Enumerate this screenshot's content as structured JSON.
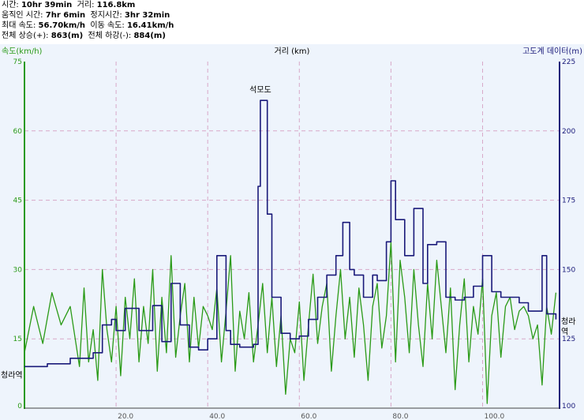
{
  "stats": {
    "time_label": "시간:",
    "time_value": "10hr 39min",
    "distance_label": "거리:",
    "distance_value": "116.8km",
    "moving_time_label": "움직인 시간:",
    "moving_time_value": "7hr 6min",
    "stopped_time_label": "정지시간:",
    "stopped_time_value": "3hr 32min",
    "max_speed_label": "최대 속도:",
    "max_speed_value": "56.70km/h",
    "moving_speed_label": "이동 속도:",
    "moving_speed_value": "16.41km/h",
    "ascent_label": "전체 상승(+):",
    "ascent_value": "863(m)",
    "descent_label": "전체 하강(-):",
    "descent_value": "884(m)"
  },
  "colors": {
    "speed": "#2a9a17",
    "elevation": "#1a1a7a",
    "background": "#eef4fc",
    "grid": "#d8a8c8"
  },
  "chart_data": {
    "type": "line",
    "left_axis_label": "속도(km/h)",
    "top_axis_label": "거리 (km)",
    "right_axis_label": "고도계 데이터(m)",
    "x_range": [
      0,
      116.8
    ],
    "x_ticks": [
      20,
      40,
      60,
      80,
      100
    ],
    "x_tick_labels": [
      "20.0",
      "40.0",
      "60.0",
      "80.0",
      "100.0"
    ],
    "y_left_range": [
      0,
      75
    ],
    "y_left_ticks": [
      0,
      15,
      30,
      45,
      60,
      75
    ],
    "y_left_tick_labels": [
      "0",
      "15",
      "30",
      "45",
      "60",
      "75"
    ],
    "y_right_range": [
      100,
      225
    ],
    "y_right_ticks": [
      100,
      125,
      150,
      175,
      200,
      225
    ],
    "y_right_tick_labels": [
      "100",
      "125",
      "150",
      "175",
      "200",
      "225"
    ],
    "grid": true,
    "series": [
      {
        "axis": "right",
        "x": [
          0,
          5,
          10,
          15,
          17,
          19,
          20,
          22,
          25,
          28,
          30,
          32,
          34,
          36,
          38,
          40,
          42,
          44,
          45,
          47,
          50,
          51,
          51.5,
          53,
          54,
          56,
          58,
          60,
          62,
          64,
          66,
          68,
          69.5,
          71,
          72,
          74,
          76,
          77,
          79,
          80,
          81,
          83,
          85,
          87,
          88,
          90,
          92,
          94,
          96,
          98,
          100,
          102,
          104,
          106,
          108,
          110,
          112,
          113,
          114,
          116
        ],
        "values": [
          115,
          116,
          118,
          120,
          130,
          132,
          128,
          136,
          128,
          137,
          124,
          145,
          130,
          122,
          121,
          125,
          155,
          128,
          123,
          122,
          123,
          180,
          211,
          170,
          140,
          127,
          125,
          126,
          132,
          140,
          148,
          155,
          167,
          150,
          148,
          140,
          148,
          146,
          160,
          182,
          168,
          155,
          172,
          145,
          159,
          160,
          140,
          139,
          140,
          144,
          155,
          142,
          140,
          140,
          138,
          135,
          135,
          155,
          134,
          132
        ]
      },
      {
        "axis": "left",
        "x": [
          0,
          2,
          4,
          6,
          8,
          10,
          12,
          13,
          14,
          15,
          16,
          17,
          18,
          19,
          20,
          21,
          22,
          23,
          24,
          25,
          26,
          27,
          28,
          29,
          30,
          31,
          32,
          33,
          34,
          35,
          36,
          37,
          38,
          39,
          40,
          41,
          42,
          43,
          44,
          45,
          46,
          47,
          48,
          49,
          50,
          51,
          52,
          53,
          54,
          55,
          56,
          57,
          58,
          59,
          60,
          61,
          62,
          63,
          64,
          65,
          66,
          67,
          68,
          69,
          70,
          71,
          72,
          73,
          74,
          75,
          76,
          77,
          78,
          79,
          80,
          81,
          82,
          83,
          84,
          85,
          86,
          87,
          88,
          89,
          90,
          91,
          92,
          93,
          94,
          95,
          96,
          97,
          98,
          99,
          100,
          101,
          102,
          103,
          104,
          105,
          106,
          107,
          108,
          109,
          110,
          111,
          112,
          113,
          114,
          115,
          116
        ],
        "values": [
          12,
          22,
          14,
          25,
          18,
          22,
          9,
          26,
          10,
          17,
          6,
          30,
          17,
          10,
          22,
          7,
          24,
          15,
          28,
          10,
          22,
          14,
          30,
          8,
          24,
          12,
          33,
          11,
          20,
          27,
          10,
          24,
          13,
          22,
          20,
          17,
          26,
          10,
          21,
          33,
          8,
          21,
          15,
          25,
          10,
          18,
          27,
          12,
          24,
          9,
          20,
          3,
          15,
          12,
          23,
          6,
          18,
          29,
          14,
          22,
          27,
          8,
          20,
          30,
          15,
          24,
          11,
          26,
          18,
          6,
          22,
          27,
          13,
          20,
          36,
          10,
          32,
          24,
          12,
          30,
          18,
          9,
          27,
          15,
          32,
          22,
          12,
          26,
          4,
          18,
          28,
          10,
          22,
          16,
          28,
          1,
          20,
          25,
          11,
          22,
          24,
          17,
          21,
          22,
          20,
          15,
          18,
          5,
          22,
          16,
          25
        ]
      }
    ],
    "annotations": [
      {
        "text": "청라역",
        "x": 0,
        "y": 115,
        "axis": "right"
      },
      {
        "text": "석모도",
        "x": 51.5,
        "y": 211,
        "axis": "right"
      },
      {
        "text": "청라역",
        "x": 116.8,
        "y": 132,
        "axis": "right"
      }
    ]
  }
}
